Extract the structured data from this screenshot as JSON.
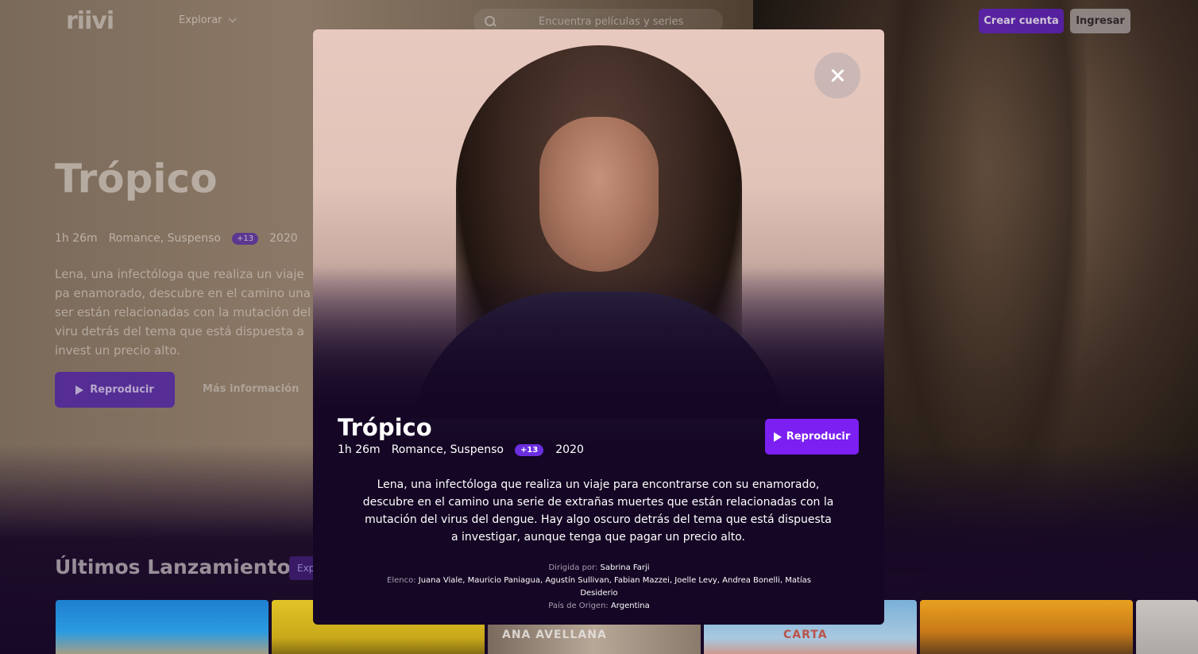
{
  "nav": {
    "logo": "riivi",
    "explore_label": "Explorar",
    "search_placeholder": "Encuentra películas y series",
    "signup_label": "Crear cuenta",
    "login_label": "Ingresar"
  },
  "hero": {
    "title": "Trópico",
    "duration": "1h 26m",
    "genres": "Romance, Suspenso",
    "rating": "+13",
    "year": "2020",
    "description": "Lena, una infectóloga que realiza un viaje pa enamorado, descubre en el camino una ser están relacionadas con la mutación del viru detrás del tema que está dispuesta a invest un precio alto.",
    "play_label": "Reproducir",
    "more_info_label": "Más información"
  },
  "section": {
    "title": "Últimos Lanzamientos",
    "explore_label": "Exp"
  },
  "cards": [
    {
      "label": ""
    },
    {
      "label": ""
    },
    {
      "label": "ANA AVELLANA"
    },
    {
      "label": "CARTA"
    },
    {
      "label": ""
    },
    {
      "label": ""
    }
  ],
  "modal": {
    "title": "Trópico",
    "duration": "1h 26m",
    "genres": "Romance, Suspenso",
    "rating": "+13",
    "year": "2020",
    "play_label": "Reproducir",
    "description": "Lena, una infectóloga que realiza un viaje para encontrarse con su enamorado, descubre en el camino una serie de extrañas muertes que están relacionadas con la mutación del virus del dengue. Hay algo oscuro detrás del tema que está dispuesta a investigar, aunque tenga que pagar un precio alto.",
    "directed_label": "Dirigida por:",
    "director": "Sabrina Farji",
    "cast_label": "Elenco:",
    "cast": "Juana Viale, Mauricio Paniagua, Agustín Sullivan, Fabian Mazzei, Joelle Levy, Andrea Bonelli, Matías Desiderio",
    "origin_label": "País de Origen:",
    "origin": "Argentina"
  },
  "colors": {
    "accent": "#7b1ff2",
    "badge": "#6a2ee0",
    "modal_bg": "#140624"
  }
}
